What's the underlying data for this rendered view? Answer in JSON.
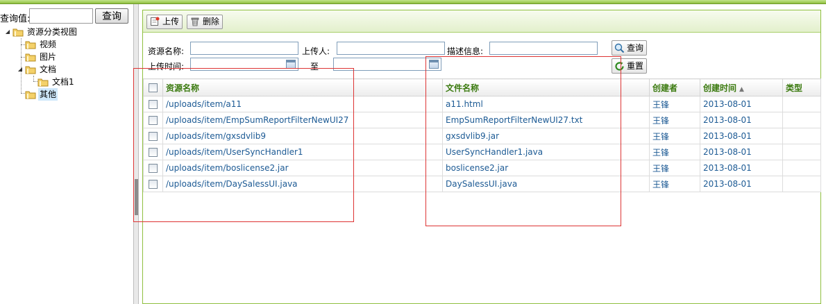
{
  "search": {
    "label": "查询值:",
    "value": "",
    "button": "查询"
  },
  "tree": {
    "root": "资源分类视图",
    "nodes": [
      {
        "label": "视频"
      },
      {
        "label": "图片"
      },
      {
        "label": "文档",
        "children": [
          {
            "label": "文档1"
          }
        ]
      },
      {
        "label": "其他",
        "selected": true
      }
    ]
  },
  "toolbar": {
    "upload": "上传",
    "delete": "删除"
  },
  "filters": {
    "resource_name": "资源名称:",
    "uploader": "上传人:",
    "description": "描述信息:",
    "upload_time": "上传时间:",
    "to": "至",
    "query": "查询",
    "reset": "重置"
  },
  "table": {
    "headers": {
      "resource_name": "资源名称",
      "file_name": "文件名称",
      "creator": "创建者",
      "created": "创建时间",
      "type": "类型"
    },
    "rows": [
      {
        "path": "/uploads/item/a11",
        "file": "a11.html",
        "creator": "王锋",
        "date": "2013-08-01",
        "type": ""
      },
      {
        "path": "/uploads/item/EmpSumReportFilterNewUI27",
        "file": "EmpSumReportFilterNewUI27.txt",
        "creator": "王锋",
        "date": "2013-08-01",
        "type": ""
      },
      {
        "path": "/uploads/item/gxsdvlib9",
        "file": "gxsdvlib9.jar",
        "creator": "王锋",
        "date": "2013-08-01",
        "type": ""
      },
      {
        "path": "/uploads/item/UserSyncHandler1",
        "file": "UserSyncHandler1.java",
        "creator": "王锋",
        "date": "2013-08-01",
        "type": ""
      },
      {
        "path": "/uploads/item/boslicense2.jar",
        "file": "boslicense2.jar",
        "creator": "王锋",
        "date": "2013-08-01",
        "type": ""
      },
      {
        "path": "/uploads/item/DaySalessUI.java",
        "file": "DaySalessUI.java",
        "creator": "王锋",
        "date": "2013-08-01",
        "type": ""
      }
    ]
  },
  "colors": {
    "accent": "#8fbf3f",
    "header_text": "#3b7a0f",
    "link": "#1c5a94",
    "annotation": "#dd3333"
  },
  "icons": {
    "upload": "upload-icon",
    "delete": "trash-icon",
    "query": "magnifier-icon",
    "reset": "refresh-icon",
    "calendar": "calendar-icon",
    "folder": "folder-icon"
  }
}
